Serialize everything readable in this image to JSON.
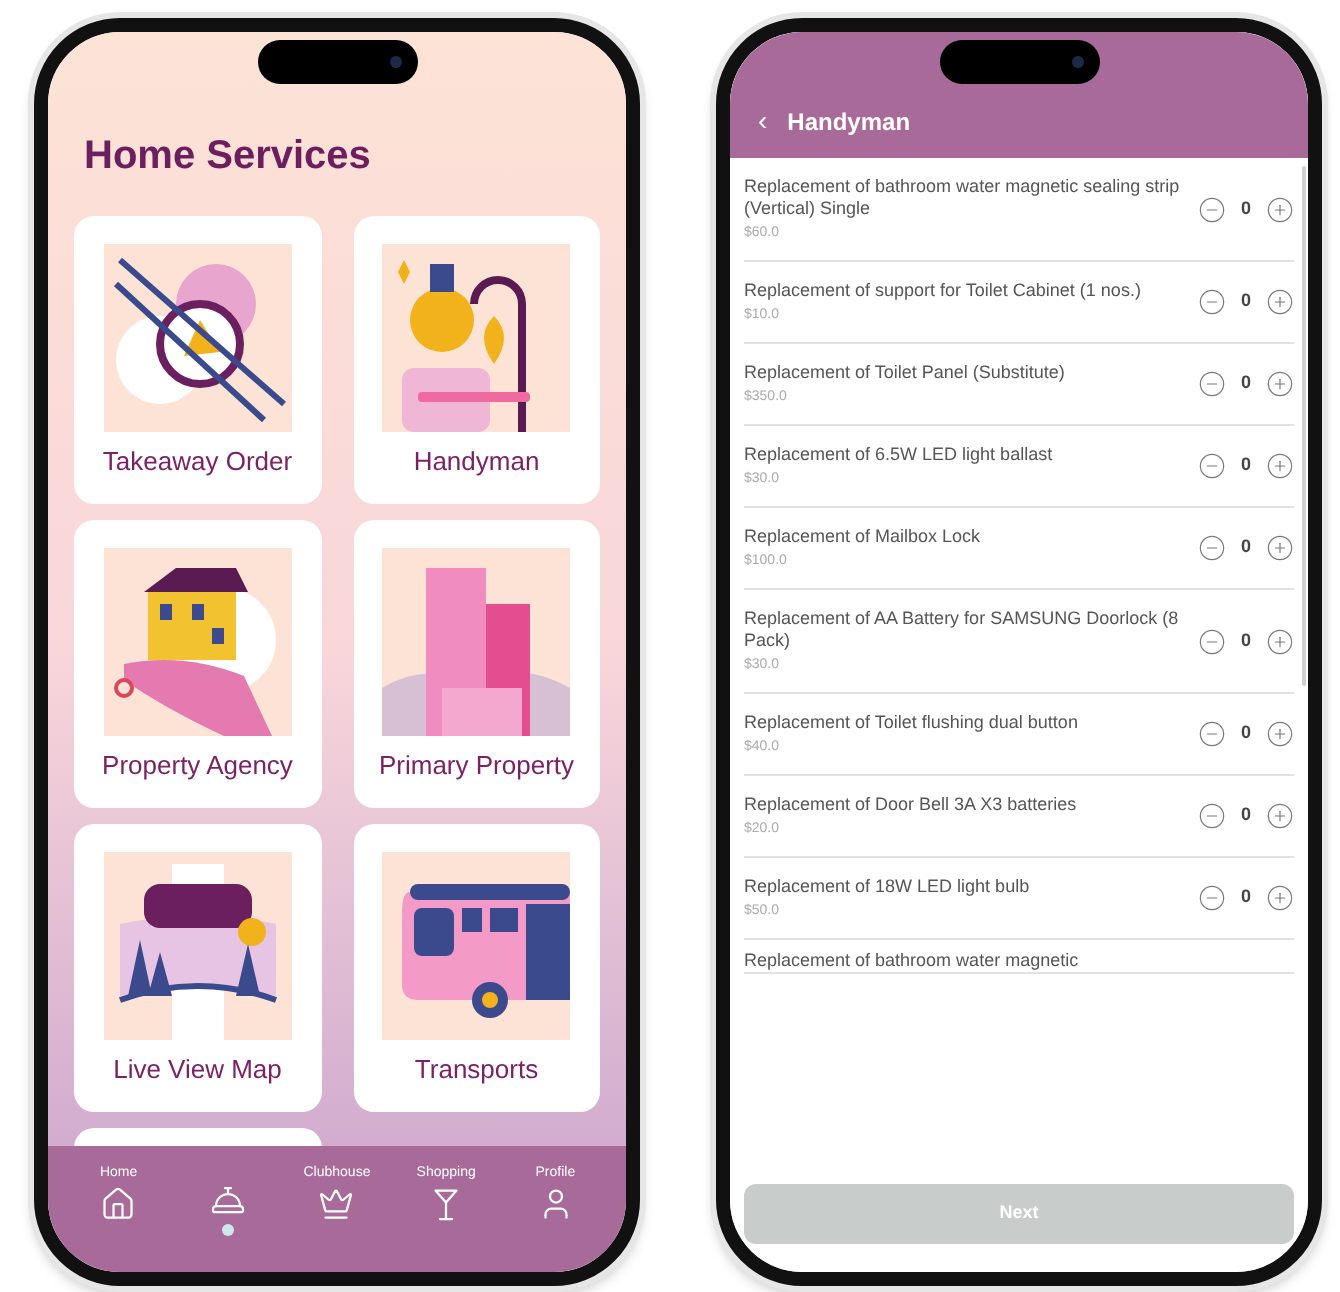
{
  "home": {
    "title": "Home Services",
    "cards": [
      {
        "kind": "food",
        "label": "Takeaway Order"
      },
      {
        "kind": "tools",
        "label": "Handyman"
      },
      {
        "kind": "house",
        "label": "Property Agency"
      },
      {
        "kind": "building",
        "label": "Primary Property"
      },
      {
        "kind": "map",
        "label": "Live View Map"
      },
      {
        "kind": "bus",
        "label": "Transports"
      },
      {
        "kind": "blank"
      }
    ],
    "nav": [
      {
        "kind": "home",
        "label": "Home",
        "selected": false
      },
      {
        "kind": "bell",
        "selected": true
      },
      {
        "kind": "crown",
        "label": "Clubhouse",
        "selected": false
      },
      {
        "kind": "cocktail",
        "label": "Shopping",
        "selected": false
      },
      {
        "kind": "person",
        "label": "Profile",
        "selected": false
      }
    ]
  },
  "handyman": {
    "back": "‹",
    "title": "Handyman",
    "items": [
      {
        "name": "Replacement of bathroom water magnetic sealing strip (Vertical) Single",
        "price": "$60.0",
        "qty": "0"
      },
      {
        "name": "Replacement of support for Toilet Cabinet (1 nos.)",
        "price": "$10.0",
        "qty": "0"
      },
      {
        "name": "Replacement of Toilet Panel (Substitute)",
        "price": "$350.0",
        "qty": "0"
      },
      {
        "name": "Replacement of 6.5W LED light ballast",
        "price": "$30.0",
        "qty": "0"
      },
      {
        "name": "Replacement of Mailbox Lock",
        "price": "$100.0",
        "qty": "0"
      },
      {
        "name": "Replacement of AA Battery for SAMSUNG Doorlock (8 Pack)",
        "price": "$30.0",
        "qty": "0"
      },
      {
        "name": "Replacement of Toilet flushing dual button",
        "price": "$40.0",
        "qty": "0"
      },
      {
        "name": "Replacement of Door Bell 3A X3 batteries",
        "price": "$20.0",
        "qty": "0"
      },
      {
        "name": "Replacement of 18W LED light bulb",
        "price": "$50.0",
        "qty": "0"
      },
      {
        "name": "Replacement of bathroom water magnetic"
      }
    ],
    "next": {
      "label": "Next",
      "disabled": true
    }
  }
}
